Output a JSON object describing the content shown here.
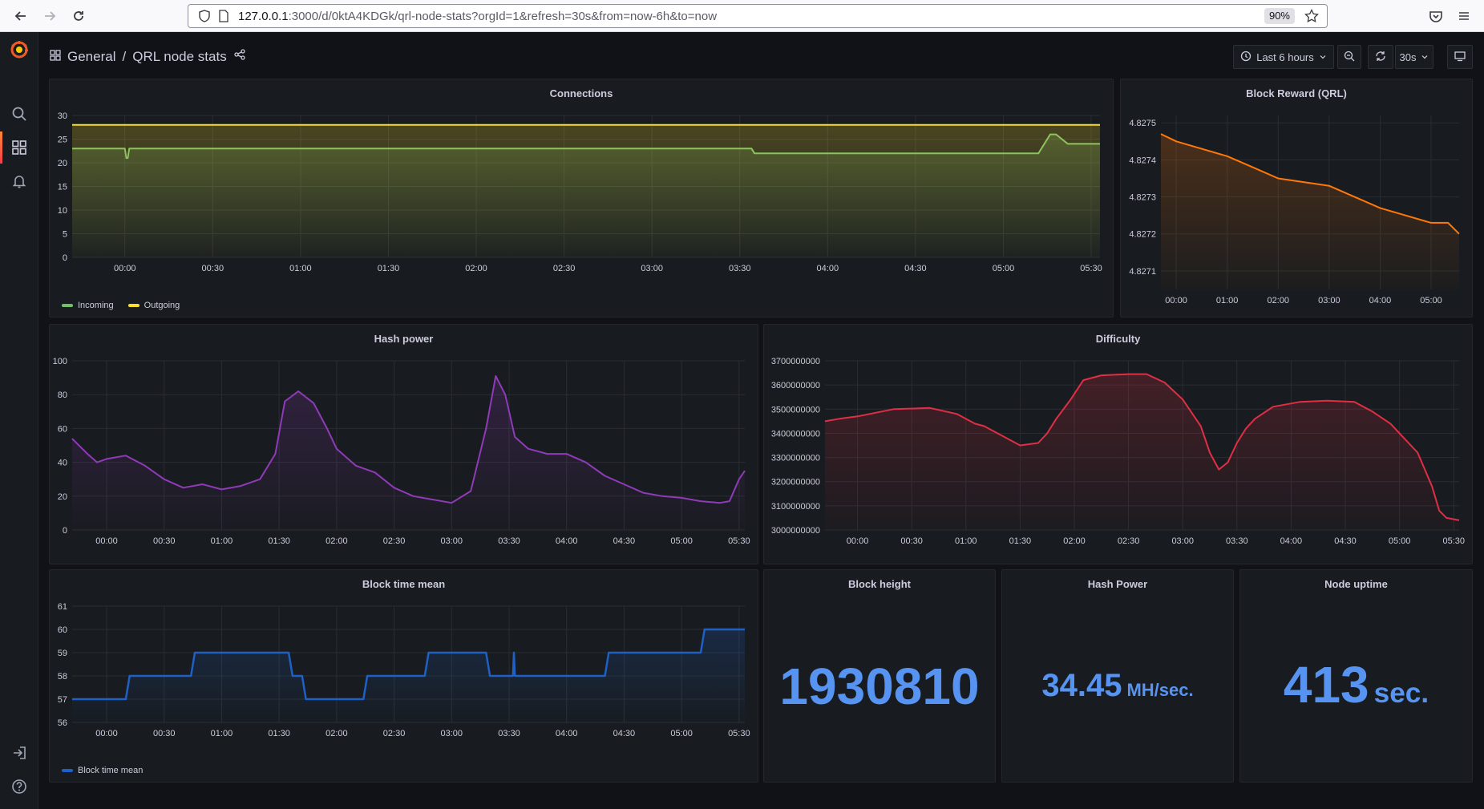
{
  "browser": {
    "url_host": "127.0.0.1",
    "url_rest": ":3000/d/0ktA4KDGk/qrl-node-stats?orgId=1&refresh=30s&from=now-6h&to=now",
    "zoom": "90%"
  },
  "breadcrumb": {
    "folder": "General",
    "separator": "/",
    "dashboard": "QRL node stats"
  },
  "toolbar": {
    "time_range": "Last 6 hours",
    "refresh_interval": "30s"
  },
  "colors": {
    "incoming": "#73bf69",
    "outgoing": "#fade2a",
    "block_reward": "#ff780a",
    "hash_power": "#8f3bb8",
    "difficulty": "#e02f44",
    "block_time": "#1f60c4",
    "stat": "#5794f2"
  },
  "panels": {
    "connections": {
      "title": "Connections"
    },
    "block_reward": {
      "title": "Block Reward (QRL)"
    },
    "hash_power": {
      "title": "Hash power"
    },
    "difficulty": {
      "title": "Difficulty"
    },
    "block_time": {
      "title": "Block time mean"
    },
    "block_height": {
      "title": "Block height",
      "value": "1930810",
      "unit": ""
    },
    "hash_power_stat": {
      "title": "Hash Power",
      "value": "34.45",
      "unit": "MH/sec."
    },
    "node_uptime": {
      "title": "Node uptime",
      "value": "413",
      "unit": "sec."
    }
  },
  "chart_data": [
    {
      "id": "connections",
      "type": "line",
      "title": "Connections",
      "x_ticks": [
        "00:00",
        "00:30",
        "01:00",
        "01:30",
        "02:00",
        "02:30",
        "03:00",
        "03:30",
        "04:00",
        "04:30",
        "05:00",
        "05:30"
      ],
      "x_range_min": [
        -18,
        333
      ],
      "ylim": [
        0,
        30
      ],
      "y_ticks": [
        "0",
        "5",
        "10",
        "15",
        "20",
        "25",
        "30"
      ],
      "legend": [
        "Incoming",
        "Outgoing"
      ],
      "series": [
        {
          "name": "Incoming",
          "x_min": [
            -18,
            0,
            0.5,
            1,
            1.5,
            2,
            214,
            215,
            333
          ],
          "values": [
            23,
            23,
            21,
            21,
            23,
            23,
            23,
            22,
            22
          ]
        },
        {
          "name": "Outgoing",
          "x_min": [
            -18,
            333
          ],
          "values": [
            28,
            28
          ]
        }
      ],
      "incoming_tail": {
        "x_min": [
          312,
          316,
          318,
          322,
          326,
          333
        ],
        "values": [
          22,
          26,
          26,
          24,
          24,
          24
        ]
      }
    },
    {
      "id": "block_reward",
      "type": "line",
      "title": "Block Reward (QRL)",
      "x_ticks": [
        "00:00",
        "01:00",
        "02:00",
        "03:00",
        "04:00",
        "05:00"
      ],
      "x_range_min": [
        -18,
        333
      ],
      "ylim": [
        4.82705,
        4.82752
      ],
      "y_ticks": [
        "4.8271",
        "4.8272",
        "4.8273",
        "4.8274",
        "4.8275"
      ],
      "series": [
        {
          "name": "",
          "x_min": [
            -18,
            0,
            30,
            60,
            90,
            120,
            150,
            180,
            210,
            240,
            270,
            300,
            320,
            333
          ],
          "values": [
            4.82747,
            4.82745,
            4.82743,
            4.82741,
            4.82738,
            4.82735,
            4.82734,
            4.82733,
            4.8273,
            4.82727,
            4.82725,
            4.82723,
            4.82723,
            4.8272
          ]
        }
      ]
    },
    {
      "id": "hash_power",
      "type": "line",
      "title": "Hash power",
      "x_ticks": [
        "00:00",
        "00:30",
        "01:00",
        "01:30",
        "02:00",
        "02:30",
        "03:00",
        "03:30",
        "04:00",
        "04:30",
        "05:00",
        "05:30"
      ],
      "x_range_min": [
        -18,
        333
      ],
      "ylim": [
        0,
        100
      ],
      "y_ticks": [
        "0",
        "20",
        "40",
        "60",
        "80",
        "100"
      ],
      "series": [
        {
          "name": "",
          "x_min": [
            -18,
            -10,
            -5,
            0,
            10,
            20,
            30,
            40,
            50,
            60,
            70,
            80,
            88,
            93,
            100,
            108,
            115,
            120,
            130,
            140,
            150,
            160,
            170,
            180,
            190,
            198,
            203,
            208,
            213,
            220,
            230,
            240,
            250,
            260,
            270,
            280,
            290,
            300,
            310,
            320,
            325,
            330,
            333
          ],
          "values": [
            54,
            45,
            40,
            42,
            44,
            38,
            30,
            25,
            27,
            24,
            26,
            30,
            45,
            76,
            82,
            75,
            60,
            48,
            38,
            34,
            25,
            20,
            18,
            16,
            23,
            60,
            91,
            80,
            55,
            48,
            45,
            45,
            40,
            32,
            27,
            22,
            20,
            19,
            17,
            16,
            17,
            30,
            35
          ]
        }
      ]
    },
    {
      "id": "difficulty",
      "type": "line",
      "title": "Difficulty",
      "x_ticks": [
        "00:00",
        "00:30",
        "01:00",
        "01:30",
        "02:00",
        "02:30",
        "03:00",
        "03:30",
        "04:00",
        "04:30",
        "05:00",
        "05:30"
      ],
      "x_range_min": [
        -18,
        333
      ],
      "ylim": [
        3000000000,
        3700000000
      ],
      "y_ticks": [
        "3000000000",
        "3100000000",
        "3200000000",
        "3300000000",
        "3400000000",
        "3500000000",
        "3600000000",
        "3700000000"
      ],
      "series": [
        {
          "name": "",
          "x_min": [
            -18,
            -10,
            0,
            20,
            40,
            55,
            65,
            70,
            80,
            90,
            100,
            105,
            110,
            118,
            125,
            135,
            150,
            160,
            170,
            180,
            190,
            195,
            200,
            205,
            210,
            215,
            220,
            230,
            245,
            260,
            275,
            285,
            295,
            300,
            310,
            318,
            322,
            326,
            333
          ],
          "values": [
            3450000000,
            3460000000,
            3470000000,
            3500000000,
            3505000000,
            3480000000,
            3440000000,
            3430000000,
            3390000000,
            3350000000,
            3360000000,
            3400000000,
            3460000000,
            3540000000,
            3620000000,
            3640000000,
            3645000000,
            3645000000,
            3610000000,
            3540000000,
            3430000000,
            3320000000,
            3250000000,
            3280000000,
            3360000000,
            3420000000,
            3460000000,
            3510000000,
            3530000000,
            3535000000,
            3530000000,
            3490000000,
            3440000000,
            3400000000,
            3320000000,
            3180000000,
            3080000000,
            3050000000,
            3040000000
          ]
        }
      ]
    },
    {
      "id": "block_time",
      "type": "line",
      "title": "Block time mean",
      "x_ticks": [
        "00:00",
        "00:30",
        "01:00",
        "01:30",
        "02:00",
        "02:30",
        "03:00",
        "03:30",
        "04:00",
        "04:30",
        "05:00",
        "05:30"
      ],
      "x_range_min": [
        -18,
        333
      ],
      "ylim": [
        56,
        61
      ],
      "y_ticks": [
        "56",
        "57",
        "58",
        "59",
        "60",
        "61"
      ],
      "legend": [
        "Block time mean"
      ],
      "series": [
        {
          "name": "Block time mean",
          "x_min": [
            -18,
            10,
            12,
            44,
            46,
            95,
            97,
            102,
            104,
            134,
            136,
            166,
            168,
            198,
            200,
            212,
            212.5,
            213,
            213.5,
            260,
            262,
            310,
            312,
            333
          ],
          "values": [
            57,
            57,
            58,
            58,
            59,
            59,
            58,
            58,
            57,
            57,
            58,
            58,
            59,
            59,
            58,
            58,
            59,
            58,
            58,
            58,
            59,
            59,
            60,
            60
          ]
        }
      ]
    }
  ]
}
